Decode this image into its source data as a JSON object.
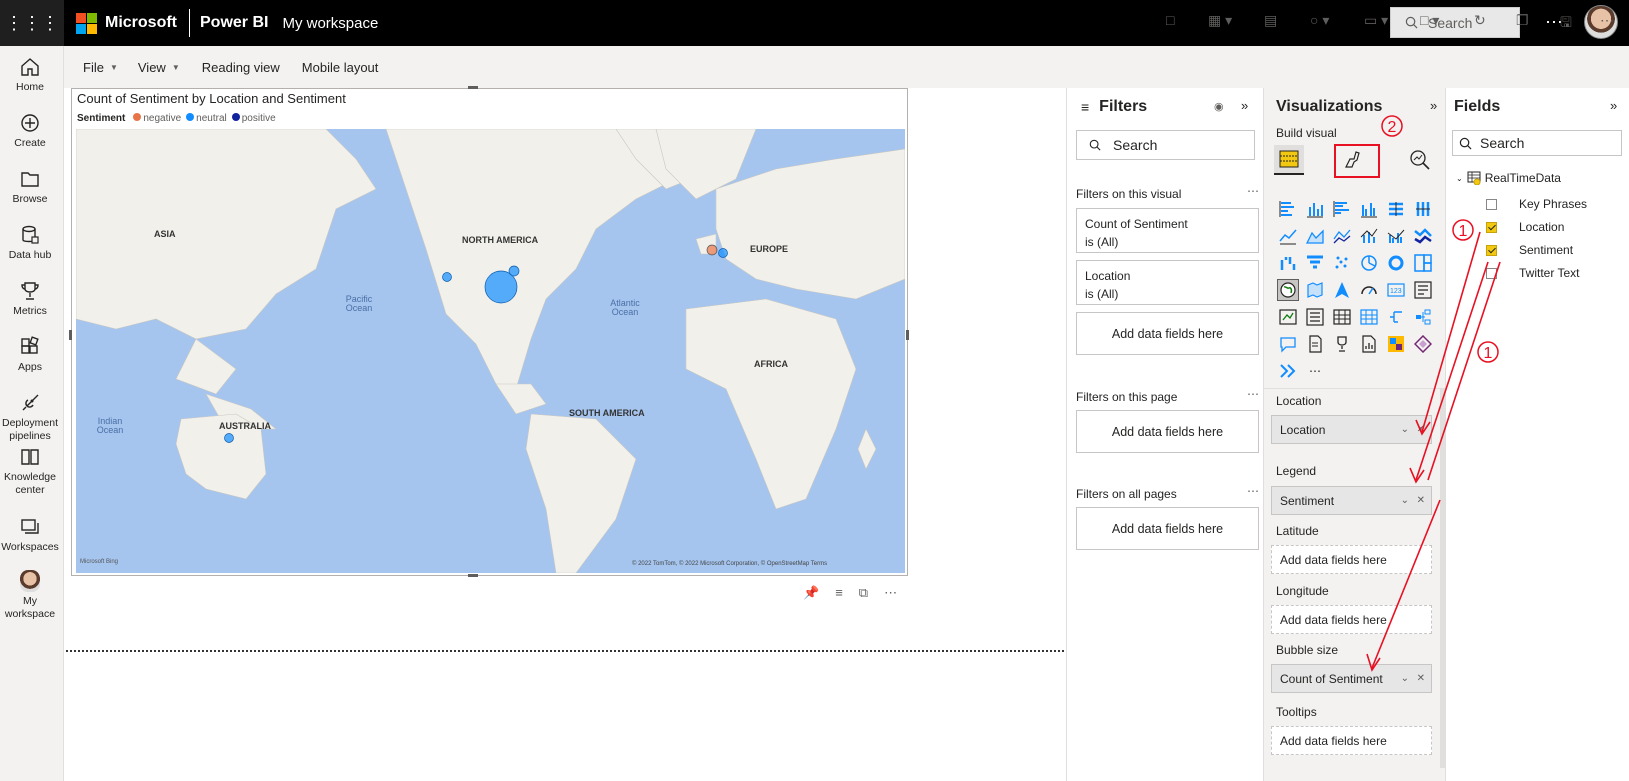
{
  "topbar": {
    "brand": "Microsoft",
    "app": "Power BI",
    "workspace": "My workspace",
    "search_placeholder": "Search",
    "more": "⋯"
  },
  "leftnav": [
    {
      "label": "Home",
      "icon": "home-icon"
    },
    {
      "label": "Create",
      "icon": "plus-circle-icon"
    },
    {
      "label": "Browse",
      "icon": "folder-icon"
    },
    {
      "label": "Data hub",
      "icon": "database-icon"
    },
    {
      "label": "Metrics",
      "icon": "trophy-icon"
    },
    {
      "label": "Apps",
      "icon": "apps-icon"
    },
    {
      "label": "Deployment pipelines",
      "icon": "rocket-icon"
    },
    {
      "label": "Knowledge center",
      "icon": "book-icon"
    },
    {
      "label": "Workspaces",
      "icon": "workspaces-icon"
    },
    {
      "label": "My workspace",
      "icon": "avatar"
    }
  ],
  "toolbar": {
    "file": "File",
    "view": "View",
    "reading_view": "Reading view",
    "mobile_layout": "Mobile layout"
  },
  "visual": {
    "title": "Count of Sentiment by Location and Sentiment",
    "legend_title": "Sentiment",
    "legend": [
      {
        "label": "negative",
        "color": "#e8754a"
      },
      {
        "label": "neutral",
        "color": "#118dff"
      },
      {
        "label": "positive",
        "color": "#12239e"
      }
    ],
    "map_labels": {
      "asia": "ASIA",
      "north_america": "NORTH AMERICA",
      "europe": "EUROPE",
      "africa": "AFRICA",
      "south_america": "SOUTH AMERICA",
      "australia": "AUSTRALIA",
      "pacific": "Pacific Ocean",
      "atlantic": "Atlantic Ocean",
      "indian": "Indian Ocean"
    },
    "bing": "Microsoft Bing",
    "copyright": "© 2022 TomTom, © 2022 Microsoft Corporation, © OpenStreetMap  Terms"
  },
  "filters": {
    "title": "Filters",
    "search_placeholder": "Search",
    "on_visual": "Filters on this visual",
    "cards": [
      {
        "name": "Count of Sentiment",
        "state": "is (All)"
      },
      {
        "name": "Location",
        "state": "is (All)"
      }
    ],
    "add_fields": "Add data fields here",
    "on_page": "Filters on this page",
    "on_all_pages": "Filters on all pages"
  },
  "visualizations": {
    "title": "Visualizations",
    "build_visual": "Build visual",
    "wells": [
      {
        "label": "Location",
        "value": "Location",
        "filled": true
      },
      {
        "label": "Legend",
        "value": "Sentiment",
        "filled": true
      },
      {
        "label": "Latitude",
        "value": "Add data fields here",
        "filled": false
      },
      {
        "label": "Longitude",
        "value": "Add data fields here",
        "filled": false
      },
      {
        "label": "Bubble size",
        "value": "Count of Sentiment",
        "filled": true
      },
      {
        "label": "Tooltips",
        "value": "Add data fields here",
        "filled": false
      }
    ]
  },
  "fields": {
    "title": "Fields",
    "search_placeholder": "Search",
    "table": "RealTimeData",
    "items": [
      {
        "label": "Key Phrases",
        "checked": false
      },
      {
        "label": "Location",
        "checked": true
      },
      {
        "label": "Sentiment",
        "checked": true
      },
      {
        "label": "Twitter Text",
        "checked": false
      }
    ]
  },
  "annotations": {
    "step1": "1",
    "step2": "2",
    "color": "#e81123"
  }
}
